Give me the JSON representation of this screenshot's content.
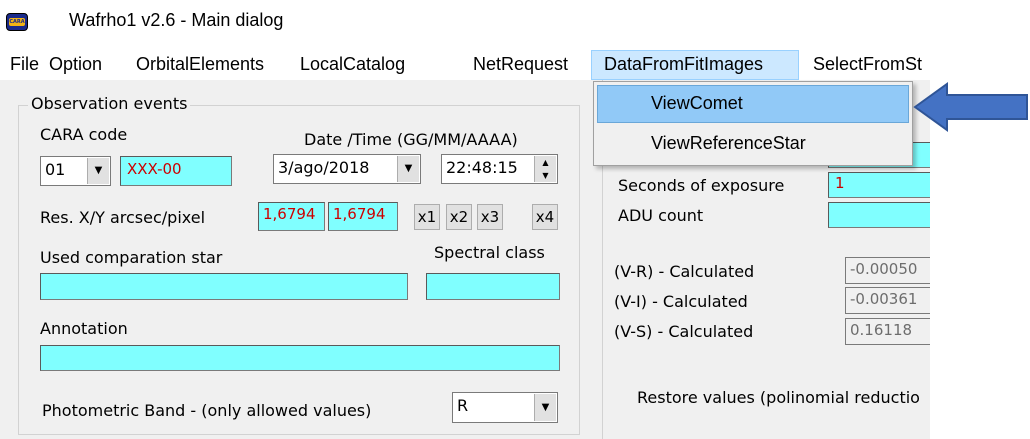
{
  "window": {
    "title": "Wafrho1 v2.6 - Main dialog",
    "icon": "cara-app-icon",
    "icon_text": "CARA"
  },
  "menu": {
    "items": [
      {
        "label": "File"
      },
      {
        "label": "Option"
      },
      {
        "label": "OrbitalElements"
      },
      {
        "label": "LocalCatalog"
      },
      {
        "label": "NetRequest"
      },
      {
        "label": "DataFromFitImages"
      },
      {
        "label": "SelectFromSt"
      }
    ],
    "active_index": 5
  },
  "dropdown": {
    "items": [
      {
        "label": "ViewComet",
        "highlighted": true
      },
      {
        "label": "ViewReferenceStar",
        "highlighted": false
      }
    ]
  },
  "observation": {
    "group_label": "Observation events",
    "cara_code_label": "CARA code",
    "cara_code_value": "01",
    "cara_id": "XXX-00",
    "datetime_label": "Date /Time  (GG/MM/AAAA)",
    "date_value": "3/ago/2018",
    "time_value": "22:48:15",
    "res_label": "Res. X/Y arcsec/pixel",
    "res_x": "1,6794",
    "res_y": "1,6794",
    "zoom_buttons": [
      "x1",
      "x2",
      "x3",
      "x4"
    ],
    "comparison_label": "Used comparation star",
    "spectral_label": "Spectral class",
    "annotation_label": "Annotation",
    "band_label": "Photometric Band  - (only allowed values)",
    "band_value": "R"
  },
  "right_panel": {
    "exposure_label": "Seconds of exposure",
    "exposure_value": "1",
    "adu_label": "ADU count",
    "vr_label": "(V-R) - Calculated",
    "vr_value": "-0.00050",
    "vi_label": "(V-I)  - Calculated",
    "vi_value": "-0.00361",
    "vs_label": "(V-S) - Calculated",
    "vs_value": "0.16118",
    "restore_label": "Restore values (polinomial reductio"
  },
  "colors": {
    "field_cyan": "#80ffff",
    "menu_highlight": "#cce8ff",
    "dropdown_highlight": "#91c9f7",
    "arrow_fill": "#4472c4",
    "error_text": "#cc0000"
  },
  "annotation_arrow": {
    "icon": "left-arrow-icon"
  }
}
